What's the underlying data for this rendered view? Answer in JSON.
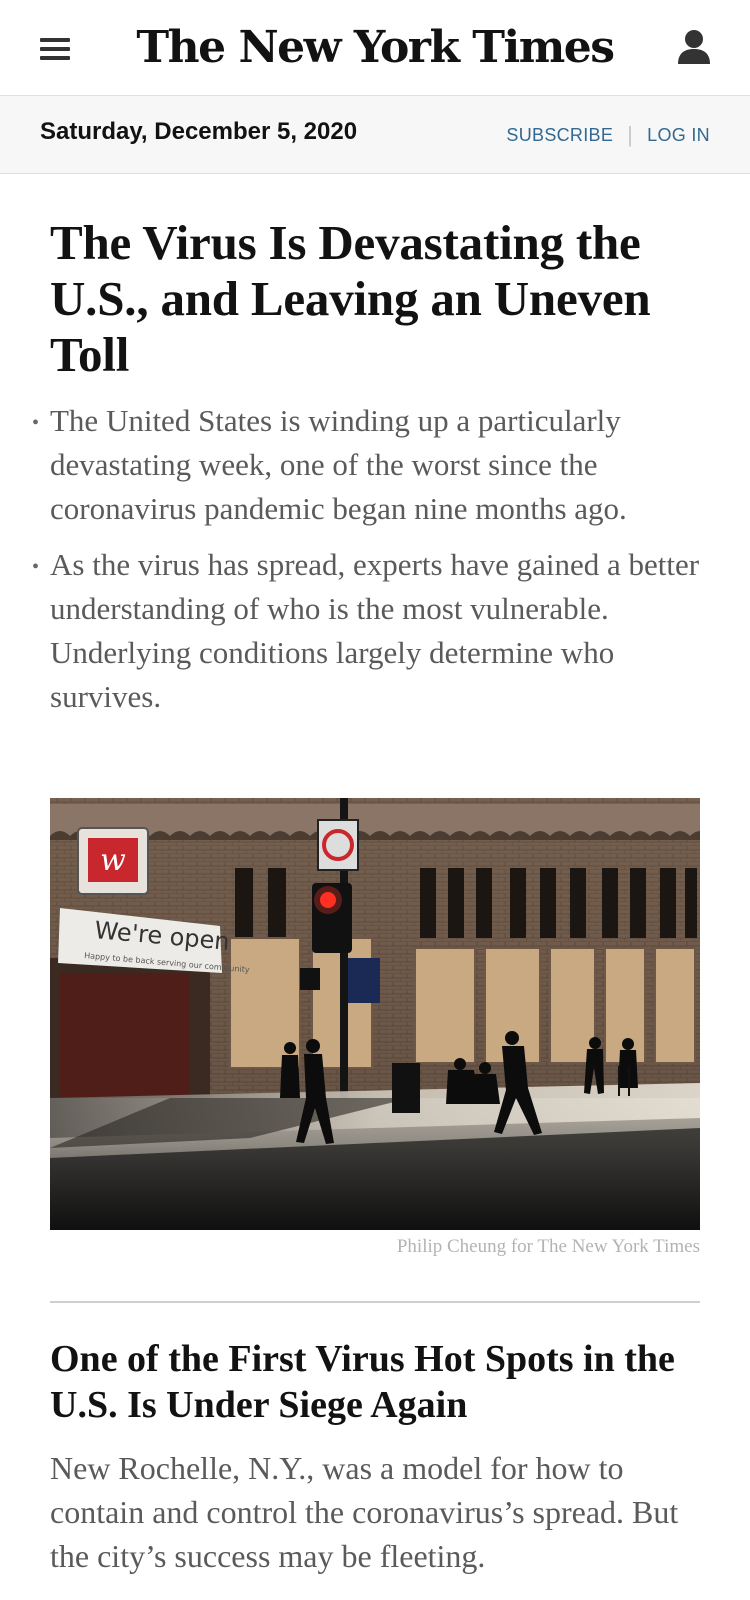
{
  "header": {
    "masthead": "The New York Times",
    "menu_icon": "hamburger-menu-icon",
    "user_icon": "user-account-icon"
  },
  "datebar": {
    "date": "Saturday, December 5, 2020",
    "subscribe_label": "SUBSCRIBE",
    "separator": "|",
    "login_label": "LOG IN"
  },
  "colors": {
    "link_blue": "#326891",
    "headline": "#121212",
    "summary_gray": "#5a5a5a",
    "credit_gray": "#b3b3b3"
  },
  "lead_story": {
    "headline": "The Virus Is Devastating the U.S., and Leaving an Uneven Toll",
    "bullets": [
      "The United States is winding up a particularly devastating week, one of the worst since the coronavirus pandemic began nine months ago.",
      "As the virus has spread, experts have gained a better understanding of who is the most vulnerable. Underlying conditions largely determine who survives."
    ],
    "photo": {
      "sign_text": "We're open",
      "sign_subtext": "Happy to be back serving our community",
      "credit": "Philip Cheung for The New York Times"
    }
  },
  "second_story": {
    "headline": "One of the First Virus Hot Spots in the U.S. Is Under Siege Again",
    "summary": "New Rochelle, N.Y., was a model for how to contain and control the coronavirus’s spread. But the city’s success may be fleeting."
  }
}
